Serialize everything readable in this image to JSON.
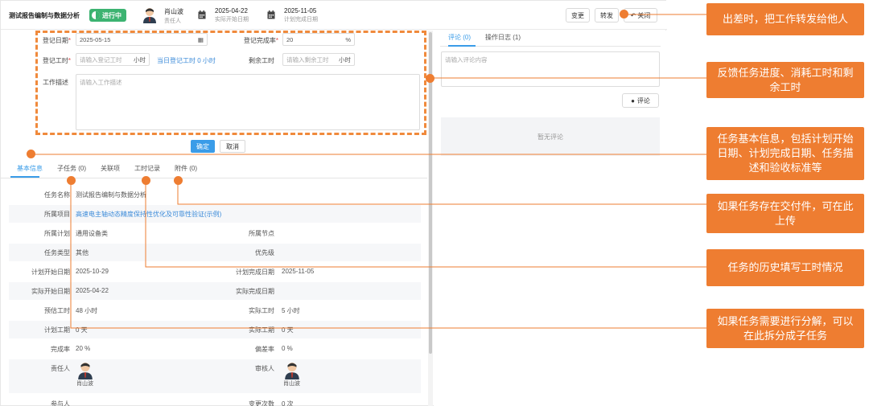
{
  "header": {
    "title": "测试报告编制与数据分析",
    "status": "进行中",
    "owner_name": "肖山波",
    "owner_label": "责任人",
    "start_date": "2025-04-22",
    "start_label": "实际开始日期",
    "end_date": "2025-11-05",
    "end_label": "计划完成日期",
    "btn_change": "变更",
    "btn_transfer": "转发",
    "btn_close": "关闭"
  },
  "form": {
    "reg_date_label": "登记日期",
    "reg_date_value": "2025-05-15",
    "reg_rate_label": "登记完成率",
    "reg_rate_value": "20",
    "reg_rate_unit": "%",
    "reg_hours_label": "登记工时",
    "reg_hours_placeholder": "请输入登记工时",
    "hours_unit": "小时",
    "today_hours": "当日登记工时 0 小时",
    "remain_label": "剩余工时",
    "remain_placeholder": "请输入剩余工时",
    "desc_label": "工作描述",
    "desc_placeholder": "请输入工作描述",
    "ok": "确定",
    "cancel": "取消"
  },
  "tabs": [
    "基本信息",
    "子任务 (0)",
    "关联项",
    "工时记录",
    "附件 (0)"
  ],
  "info": {
    "task_name_k": "任务名称",
    "task_name_v": "测试报告编制与数据分析",
    "project_k": "所属项目",
    "project_v": "高速电主轴动态精度保持性优化及可靠性验证(示例)",
    "plan_k": "所属计划",
    "plan_v": "通用设备类",
    "node_k": "所属节点",
    "node_v": "",
    "type_k": "任务类型",
    "type_v": "其他",
    "priority_k": "优先级",
    "priority_v": "",
    "plan_start_k": "计划开始日期",
    "plan_start_v": "2025-10-29",
    "plan_end_k": "计划完成日期",
    "plan_end_v": "2025-11-05",
    "act_start_k": "实际开始日期",
    "act_start_v": "2025-04-22",
    "act_end_k": "实际完成日期",
    "act_end_v": "",
    "est_hours_k": "预估工时",
    "est_hours_v": "48 小时",
    "act_hours_k": "实际工时",
    "act_hours_v": "5 小时",
    "plan_days_k": "计划工期",
    "plan_days_v": "0 天",
    "act_days_k": "实际工期",
    "act_days_v": "0 天",
    "completion_k": "完成率",
    "completion_v": "20 %",
    "deviation_k": "偏差率",
    "deviation_v": "0 %",
    "owner_k": "责任人",
    "owner_v": "肖山波",
    "reviewer_k": "审核人",
    "reviewer_v": "肖山波",
    "participant_k": "参与人",
    "change_count_k": "变更次数",
    "change_count_v": "0 次"
  },
  "right": {
    "tab_comment": "评论 (0)",
    "tab_log": "操作日志 (1)",
    "comment_placeholder": "请输入评论内容",
    "comment_btn": "评论",
    "empty": "暂无评论"
  },
  "callouts": {
    "c1": "出差时，把工作转发给他人",
    "c2": "反馈任务进度、消耗工时和剩余工时",
    "c3": "任务基本信息，包括计划开始日期、计划完成日期、任务描述和验收标准等",
    "c4": "如果任务存在交付件，可在此上传",
    "c5": "任务的历史填写工时情况",
    "c6": "如果任务需要进行分解，可以在此拆分成子任务"
  },
  "colors": {
    "accent": "#3a9ce8",
    "status": "#3cb371",
    "callout": "#ee7d31"
  }
}
